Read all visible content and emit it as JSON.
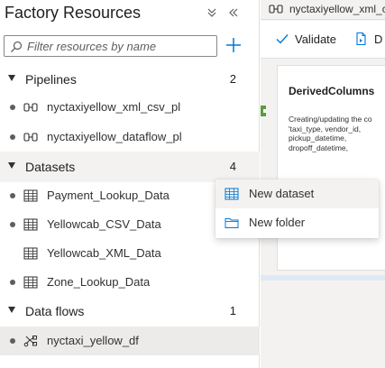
{
  "panel": {
    "title": "Factory Resources",
    "collapse_all_icon": "double-chevron-down-icon",
    "minimize_icon": "double-chevron-left-icon",
    "search": {
      "placeholder": "Filter resources by name",
      "value": ""
    },
    "add_icon": "plus-icon"
  },
  "sections": {
    "pipelines": {
      "label": "Pipelines",
      "count": "2",
      "items": [
        {
          "name": "nyctaxiyellow_xml_csv_pl",
          "icon": "pipeline-icon"
        },
        {
          "name": "nyctaxiyellow_dataflow_pl",
          "icon": "pipeline-icon"
        }
      ]
    },
    "datasets": {
      "label": "Datasets",
      "count": "4",
      "items": [
        {
          "name": "Payment_Lookup_Data",
          "icon": "table-icon"
        },
        {
          "name": "Yellowcab_CSV_Data",
          "icon": "table-icon"
        },
        {
          "name": "Yellowcab_XML_Data",
          "icon": "table-icon"
        },
        {
          "name": "Zone_Lookup_Data",
          "icon": "table-icon"
        }
      ]
    },
    "dataflows": {
      "label": "Data flows",
      "count": "1",
      "items": [
        {
          "name": "nyctaxi_yellow_df",
          "icon": "dataflow-icon"
        }
      ]
    }
  },
  "context_menu": {
    "items": [
      {
        "label": "New dataset",
        "icon": "table-icon"
      },
      {
        "label": "New folder",
        "icon": "folder-icon"
      }
    ]
  },
  "editor": {
    "tab_label": "nyctaxiyellow_xml_csv_pl",
    "toolbar": {
      "validate_label": "Validate",
      "debug_label": "D"
    },
    "node": {
      "title": "DerivedColumns",
      "description": "Creating/updating the co 'taxi_type, vendor_id, pickup_datetime, dropoff_datetime,"
    }
  },
  "colors": {
    "accent": "#0078d4",
    "selected_row": "#edebe9",
    "section_bg": "#f3f2f1",
    "connector": "#5c9c3c"
  }
}
